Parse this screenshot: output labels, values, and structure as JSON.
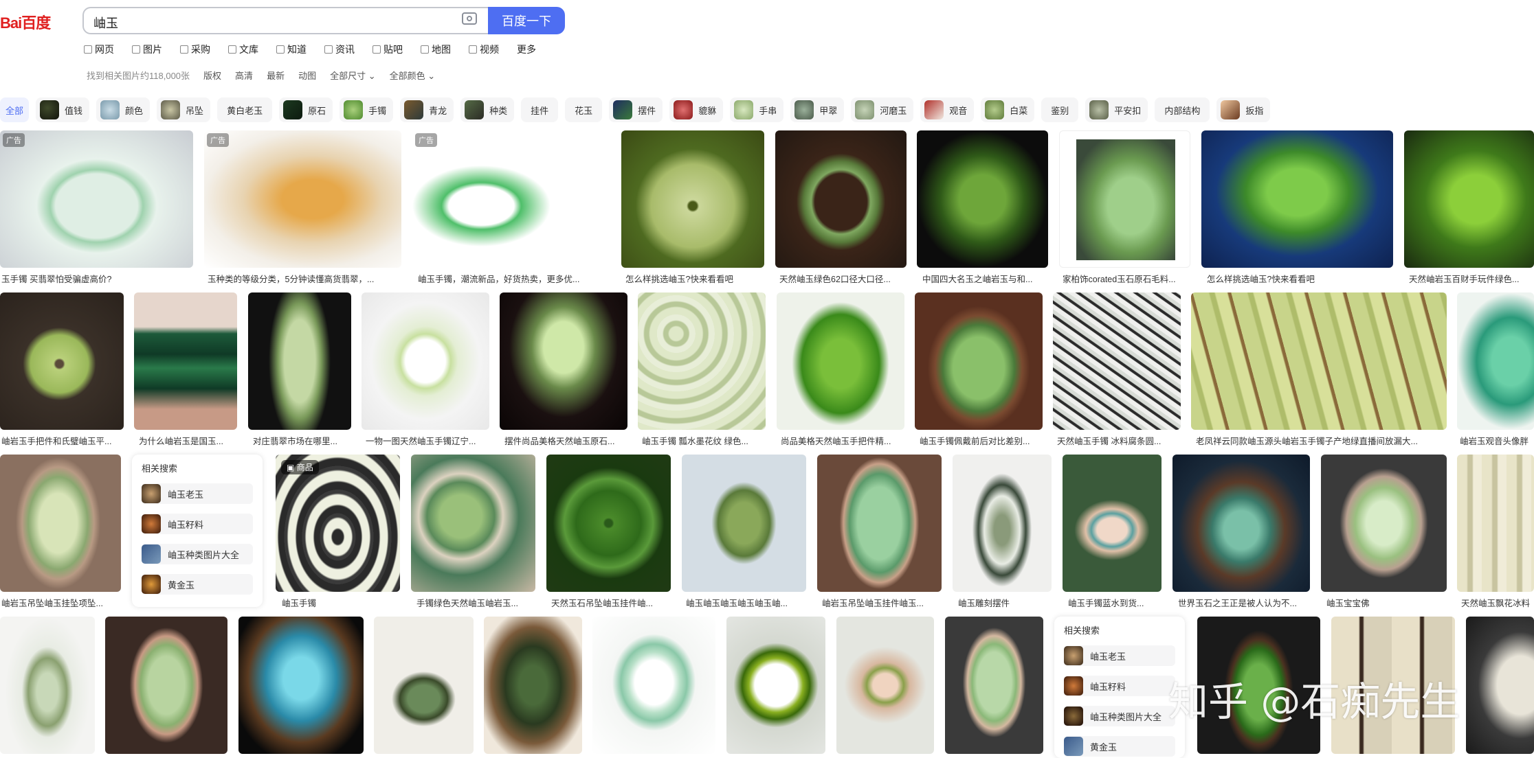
{
  "header": {
    "logo_text": "Bai百度",
    "search_value": "岫玉",
    "search_button": "百度一下"
  },
  "tabs": [
    "网页",
    "图片",
    "采购",
    "文库",
    "知道",
    "资讯",
    "贴吧",
    "地图",
    "视频",
    "更多"
  ],
  "filters": {
    "count": "找到相关图片约118,000张",
    "items": [
      "版权",
      "高清",
      "最新",
      "动图",
      "全部尺寸",
      "全部颜色"
    ]
  },
  "categories": [
    {
      "label": "全部"
    },
    {
      "label": "值钱"
    },
    {
      "label": "颜色"
    },
    {
      "label": "吊坠"
    },
    {
      "label": "黄白老玉"
    },
    {
      "label": "原石"
    },
    {
      "label": "手镯"
    },
    {
      "label": "青龙"
    },
    {
      "label": "种类"
    },
    {
      "label": "挂件"
    },
    {
      "label": "花玉"
    },
    {
      "label": "摆件"
    },
    {
      "label": "貔貅"
    },
    {
      "label": "手串"
    },
    {
      "label": "甲翠"
    },
    {
      "label": "河磨玉"
    },
    {
      "label": "观音"
    },
    {
      "label": "白菜"
    },
    {
      "label": "鉴别"
    },
    {
      "label": "平安扣"
    },
    {
      "label": "内部结构"
    },
    {
      "label": "扳指"
    }
  ],
  "badges": {
    "ad": "广告",
    "shop": "商品"
  },
  "grid": {
    "row1": [
      {
        "caption": "玉手镯 买翡翠怕受骗虚高价?"
      },
      {
        "caption": "玉种类的等级分类，5分钟读懂高货翡翠，..."
      },
      {
        "caption": "岫玉手镯，潮流新品，好货热卖，更多优..."
      },
      {
        "caption": "怎么样挑选岫玉?快来看看吧"
      },
      {
        "caption": "天然岫玉绿色62口径大口径..."
      },
      {
        "caption": "中国四大名玉之岫岩玉与和..."
      },
      {
        "caption": "家柏饰corated玉石原石毛料..."
      },
      {
        "caption": "怎么样挑选岫玉?快来看看吧"
      },
      {
        "caption": "天然岫岩玉百财手玩件绿色..."
      }
    ],
    "row2": [
      {
        "caption": "岫岩玉手把件和氏璧岫玉平..."
      },
      {
        "caption": "为什么岫岩玉是国玉..."
      },
      {
        "caption": "对庄翡翠市场在哪里..."
      },
      {
        "caption": "一物一图天然岫玉手镯辽宁..."
      },
      {
        "caption": "摆件尚品美格天然岫玉原石..."
      },
      {
        "caption": "岫玉手镯 瓢水墨花纹 绿色..."
      },
      {
        "caption": "尚品美格天然岫玉手把件精..."
      },
      {
        "caption": "岫玉手镯佩戴前后对比差别..."
      },
      {
        "caption": "天然岫玉手镯 冰料腐条圆..."
      },
      {
        "caption": "老凤祥云同款岫玉源头岫岩玉手镯子产地绿直播间放漏大..."
      },
      {
        "caption": "岫岩玉观音头像胖"
      }
    ],
    "row3": [
      {
        "caption": "岫岩玉吊坠岫玉挂坠项坠..."
      },
      {
        "caption": "岫玉手镯"
      },
      {
        "caption": "手镯绿色天然岫玉岫岩玉..."
      },
      {
        "caption": "天然玉石吊坠岫玉挂件岫..."
      },
      {
        "caption": "岫玉岫玉岫玉岫玉岫玉岫..."
      },
      {
        "caption": "岫岩玉吊坠岫玉挂件岫玉..."
      },
      {
        "caption": "岫玉雕刻摆件"
      },
      {
        "caption": "岫玉手镯蓝水到货..."
      },
      {
        "caption": "世界玉石之王正是被人认为不..."
      },
      {
        "caption": "岫玉宝宝佛"
      },
      {
        "caption": "天然岫玉飘花冰料"
      }
    ]
  },
  "related": {
    "title": "相关搜索",
    "items": [
      "岫玉老玉",
      "岫玉籽料",
      "岫玉种类图片大全",
      "黄金玉"
    ]
  },
  "watermark": "知乎 @石痴先生",
  "colors": {
    "brand_blue": "#4e6ef2",
    "brand_red": "#e02020",
    "jade": "#6fae4a"
  }
}
